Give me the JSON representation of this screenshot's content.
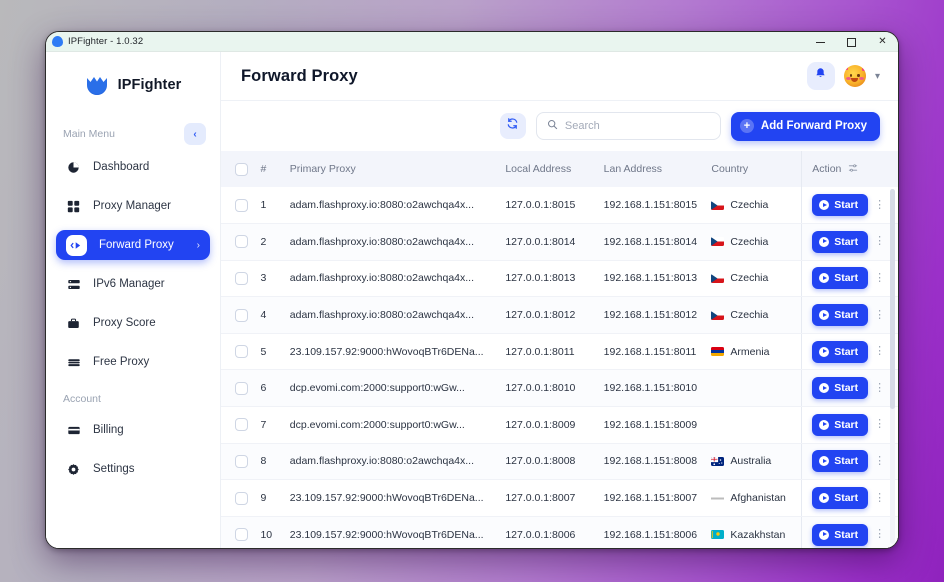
{
  "window": {
    "titlebar_title": "IPFighter - 1.0.32",
    "controls": {
      "minimize": "–",
      "maximize": "□",
      "close": "✕"
    }
  },
  "sidebar": {
    "brand": "IPFighter",
    "section_main": "Main Menu",
    "collapse_icon": "‹",
    "items": [
      {
        "label": "Dashboard",
        "icon": "pie-chart-icon",
        "active": false
      },
      {
        "label": "Proxy Manager",
        "icon": "grid-icon",
        "active": false
      },
      {
        "label": "Forward Proxy",
        "icon": "forward-arrow-icon",
        "active": true,
        "chevron": "›"
      },
      {
        "label": "IPv6 Manager",
        "icon": "server-icon",
        "active": false
      },
      {
        "label": "Proxy Score",
        "icon": "briefcase-icon",
        "active": false
      },
      {
        "label": "Free Proxy",
        "icon": "stack-icon",
        "active": false
      }
    ],
    "section_account": "Account",
    "account_items": [
      {
        "label": "Billing",
        "icon": "credit-card-icon"
      },
      {
        "label": "Settings",
        "icon": "gear-icon"
      }
    ]
  },
  "header": {
    "title": "Forward Proxy",
    "bell_icon": "bell-icon",
    "avatar_icon": "party-face-avatar",
    "chevron_icon": "chevron-down-icon"
  },
  "toolbar": {
    "refresh_icon": "refresh-icon",
    "search_placeholder": "Search",
    "search_value": "",
    "search_icon": "search-icon",
    "add_label": "Add Forward Proxy",
    "add_plus_icon": "plus-icon"
  },
  "table": {
    "columns": [
      "",
      "#",
      "Primary Proxy",
      "Local Address",
      "Lan Address",
      "Country",
      "Action"
    ],
    "action_sort_icon": "sort-settings-icon",
    "rows": [
      {
        "num": "1",
        "proxy": "adam.flashproxy.io:8080:o2awchqa4x...",
        "local": "127.0.0.1:8015",
        "lan": "192.168.1.151:8015",
        "country": "Czechia",
        "flag": "cz",
        "action": "Start"
      },
      {
        "num": "2",
        "proxy": "adam.flashproxy.io:8080:o2awchqa4x...",
        "local": "127.0.0.1:8014",
        "lan": "192.168.1.151:8014",
        "country": "Czechia",
        "flag": "cz",
        "action": "Start"
      },
      {
        "num": "3",
        "proxy": "adam.flashproxy.io:8080:o2awchqa4x...",
        "local": "127.0.0.1:8013",
        "lan": "192.168.1.151:8013",
        "country": "Czechia",
        "flag": "cz",
        "action": "Start"
      },
      {
        "num": "4",
        "proxy": "adam.flashproxy.io:8080:o2awchqa4x...",
        "local": "127.0.0.1:8012",
        "lan": "192.168.1.151:8012",
        "country": "Czechia",
        "flag": "cz",
        "action": "Start"
      },
      {
        "num": "5",
        "proxy": "23.109.157.92:9000:hWovoqBTr6DENa...",
        "local": "127.0.0.1:8011",
        "lan": "192.168.1.151:8011",
        "country": "Armenia",
        "flag": "am",
        "action": "Start"
      },
      {
        "num": "6",
        "proxy": "dcp.evomi.com:2000:support0:wGw...",
        "local": "127.0.0.1:8010",
        "lan": "192.168.1.151:8010",
        "country": "",
        "flag": "",
        "action": "Start"
      },
      {
        "num": "7",
        "proxy": "dcp.evomi.com:2000:support0:wGw...",
        "local": "127.0.0.1:8009",
        "lan": "192.168.1.151:8009",
        "country": "",
        "flag": "",
        "action": "Start"
      },
      {
        "num": "8",
        "proxy": "adam.flashproxy.io:8080:o2awchqa4x...",
        "local": "127.0.0.1:8008",
        "lan": "192.168.1.151:8008",
        "country": "Australia",
        "flag": "au",
        "action": "Start"
      },
      {
        "num": "9",
        "proxy": "23.109.157.92:9000:hWovoqBTr6DENa...",
        "local": "127.0.0.1:8007",
        "lan": "192.168.1.151:8007",
        "country": "Afghanistan",
        "flag": "af",
        "action": "Start"
      },
      {
        "num": "10",
        "proxy": "23.109.157.92:9000:hWovoqBTr6DENa...",
        "local": "127.0.0.1:8006",
        "lan": "192.168.1.151:8006",
        "country": "Kazakhstan",
        "flag": "kz",
        "action": "Start"
      }
    ],
    "kebab_icon": "more-vertical-icon"
  },
  "colors": {
    "accent": "#2244f2",
    "accent_soft": "#e8edfd",
    "header_row": "#f3f5fb",
    "text": "#2b3342",
    "muted": "#6f7789"
  }
}
